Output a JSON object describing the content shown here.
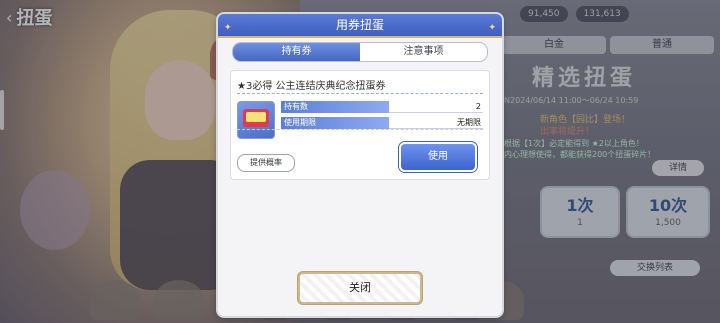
{
  "background": {
    "title": "扭蛋",
    "back_icon": "‹",
    "top_right_pills": [
      "91,450",
      "131,613"
    ],
    "banner_tabs": [
      "白金",
      "普通"
    ],
    "banner_title": "精选扭蛋",
    "banner_date": "N2024/06/14 11:00～06/24 10:59",
    "banner_line1": "新角色【园比】登场！",
    "banner_line2": "出率将提升！",
    "banner_line3": "根据【1次】必定能得到 ★2以上角色！\n内心理想使得，都能获得200个扭蛋碎片！",
    "detail_button": "详情",
    "pull_cards": [
      {
        "big": "1次",
        "small": "1"
      },
      {
        "big": "10次",
        "small": "1,500"
      }
    ],
    "exchange_button": "交换列表"
  },
  "modal": {
    "header_title": "用券扭蛋",
    "tabs": {
      "active": "持有券",
      "inactive": "注意事项"
    },
    "ticket": {
      "name": "★3必得 公主连结庆典纪念扭蛋券",
      "rows": [
        {
          "label": "持有数",
          "value": "2"
        },
        {
          "label": "使用期限",
          "value": "无期限"
        }
      ],
      "rate_button": "提供概率",
      "use_button": "使用"
    },
    "close_button": "关闭"
  },
  "colors": {
    "header_blue": "#4a6ccc",
    "accent_gold": "#d8b85a",
    "button_blue": "#4a6ed6"
  }
}
